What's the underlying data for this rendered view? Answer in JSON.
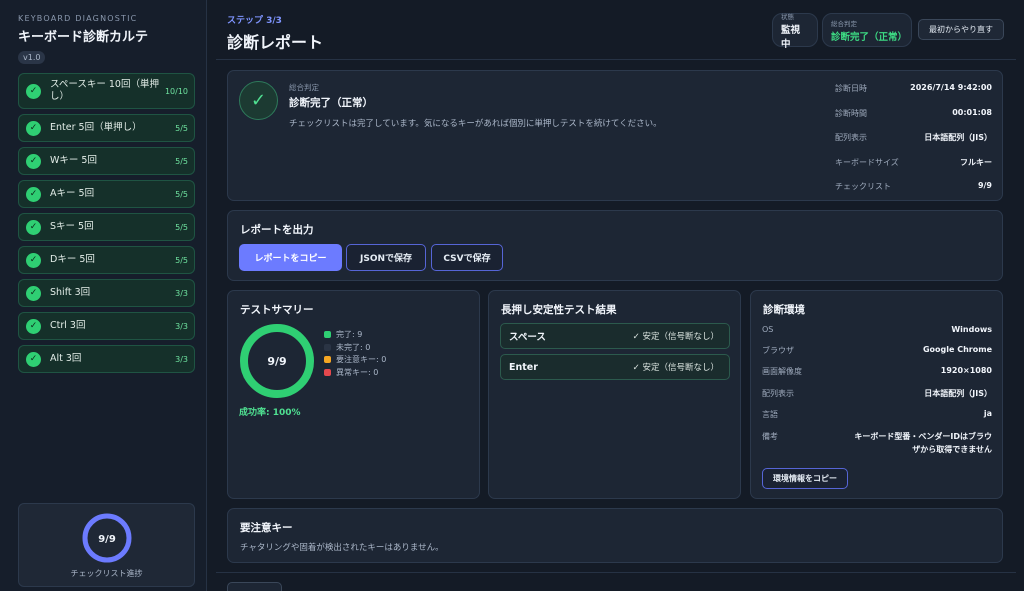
{
  "sidebar": {
    "eyebrow": "KEYBOARD DIAGNOSTIC",
    "title": "キーボード診断カルテ",
    "version": "v1.0",
    "checklist": [
      {
        "label": "スペースキー 10回（単押し）",
        "count": "10/10"
      },
      {
        "label": "Enter 5回（単押し）",
        "count": "5/5"
      },
      {
        "label": "Wキー 5回",
        "count": "5/5"
      },
      {
        "label": "Aキー 5回",
        "count": "5/5"
      },
      {
        "label": "Sキー 5回",
        "count": "5/5"
      },
      {
        "label": "Dキー 5回",
        "count": "5/5"
      },
      {
        "label": "Shift 3回",
        "count": "3/3"
      },
      {
        "label": "Ctrl 3回",
        "count": "3/3"
      },
      {
        "label": "Alt 3回",
        "count": "3/3"
      }
    ],
    "progress": {
      "text": "9/9",
      "fraction": 1.0,
      "label": "チェックリスト進捗"
    }
  },
  "header": {
    "step": "ステップ 3/3",
    "title": "診断レポート",
    "status_label": "状態",
    "status_value": "監視中",
    "verdict_label": "総合判定",
    "verdict_value": "診断完了（正常）",
    "restart_label": "最初からやり直す"
  },
  "verdict": {
    "eyebrow": "総合判定",
    "title": "診断完了（正常）",
    "description": "チェックリストは完了しています。気になるキーがあれば個別に単押しテストを続けてください。",
    "meta": [
      {
        "key": "診断日時",
        "value": "2026/7/14 9:42:00"
      },
      {
        "key": "診断時間",
        "value": "00:01:08"
      },
      {
        "key": "配列表示",
        "value": "日本語配列（JIS）"
      },
      {
        "key": "キーボードサイズ",
        "value": "フルキー"
      },
      {
        "key": "チェックリスト",
        "value": "9/9"
      }
    ]
  },
  "export": {
    "title": "レポートを出力",
    "copy_label": "レポートをコピー",
    "json_label": "JSONで保存",
    "csv_label": "CSVで保存"
  },
  "summary": {
    "title": "テストサマリー",
    "center_text": "9/9",
    "fraction": 1.0,
    "legend": [
      {
        "label": "完了: 9",
        "color": "#2fcf73"
      },
      {
        "label": "未完了: 0",
        "color": "#2a3444"
      },
      {
        "label": "要注意キー: 0",
        "color": "#f5a623"
      },
      {
        "label": "異常キー: 0",
        "color": "#e5484d"
      }
    ],
    "success_rate": "成功率: 100%"
  },
  "hold": {
    "title": "長押し安定性テスト結果",
    "rows": [
      {
        "key": "スペース",
        "value": "✓ 安定（信号断なし）"
      },
      {
        "key": "Enter",
        "value": "✓ 安定（信号断なし）"
      }
    ]
  },
  "env": {
    "title": "診断環境",
    "rows": [
      {
        "key": "OS",
        "value": "Windows"
      },
      {
        "key": "ブラウザ",
        "value": "Google Chrome"
      },
      {
        "key": "画面解像度",
        "value": "1920×1080"
      },
      {
        "key": "配列表示",
        "value": "日本語配列（JIS）"
      },
      {
        "key": "言語",
        "value": "ja"
      },
      {
        "key": "備考",
        "value": "キーボード型番・ベンダーIDはブラウザから取得できません"
      }
    ],
    "copy_label": "環境情報をコピー"
  },
  "attention": {
    "title": "要注意キー",
    "description": "チャタリングや固着が検出されたキーはありません。"
  },
  "colors": {
    "accent": "#6c7bff",
    "success": "#2fcf73",
    "background": "#141b26"
  }
}
